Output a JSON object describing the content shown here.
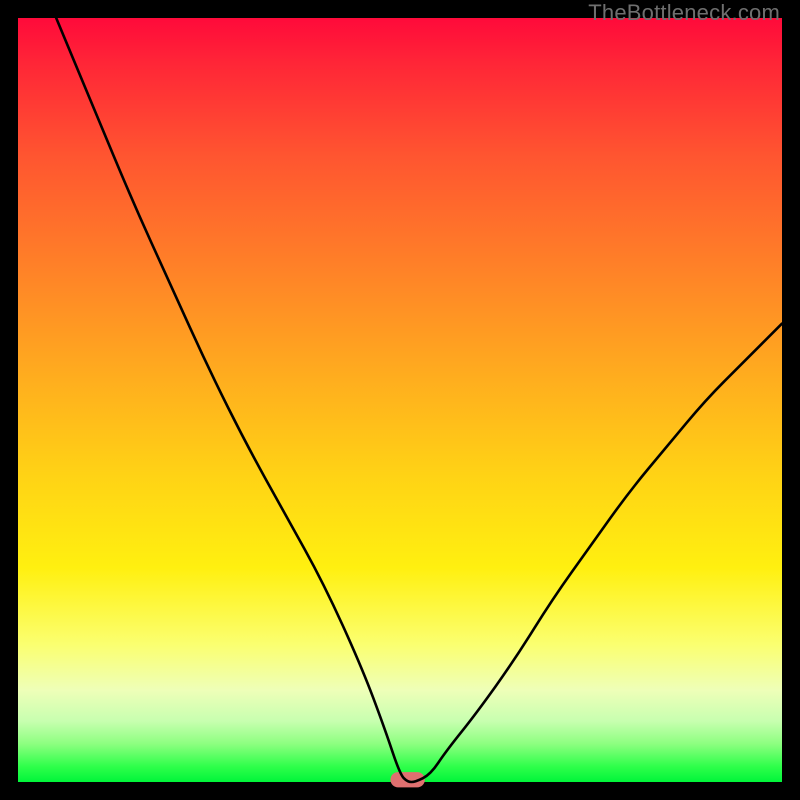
{
  "watermark": {
    "text": "TheBottleneck.com"
  },
  "chart_data": {
    "type": "line",
    "title": "",
    "xlabel": "",
    "ylabel": "",
    "xlim": [
      0,
      100
    ],
    "ylim": [
      0,
      100
    ],
    "grid": false,
    "background": "green-yellow-red-gradient",
    "series": [
      {
        "name": "bottleneck-curve",
        "color": "#000000",
        "x": [
          5,
          10,
          15,
          20,
          25,
          30,
          35,
          40,
          45,
          48,
          50,
          51,
          52,
          54,
          56,
          60,
          65,
          70,
          75,
          80,
          85,
          90,
          95,
          100
        ],
        "y": [
          100,
          88,
          76,
          65,
          54,
          44,
          35,
          26,
          15,
          7,
          1,
          0,
          0,
          1,
          4,
          9,
          16,
          24,
          31,
          38,
          44,
          50,
          55,
          60
        ]
      }
    ],
    "marker": {
      "name": "optimum-marker",
      "shape": "rounded-rect",
      "color": "#e07070",
      "x": 51,
      "y": 0,
      "width_pct": 4.5,
      "height_pct": 2.0
    }
  }
}
